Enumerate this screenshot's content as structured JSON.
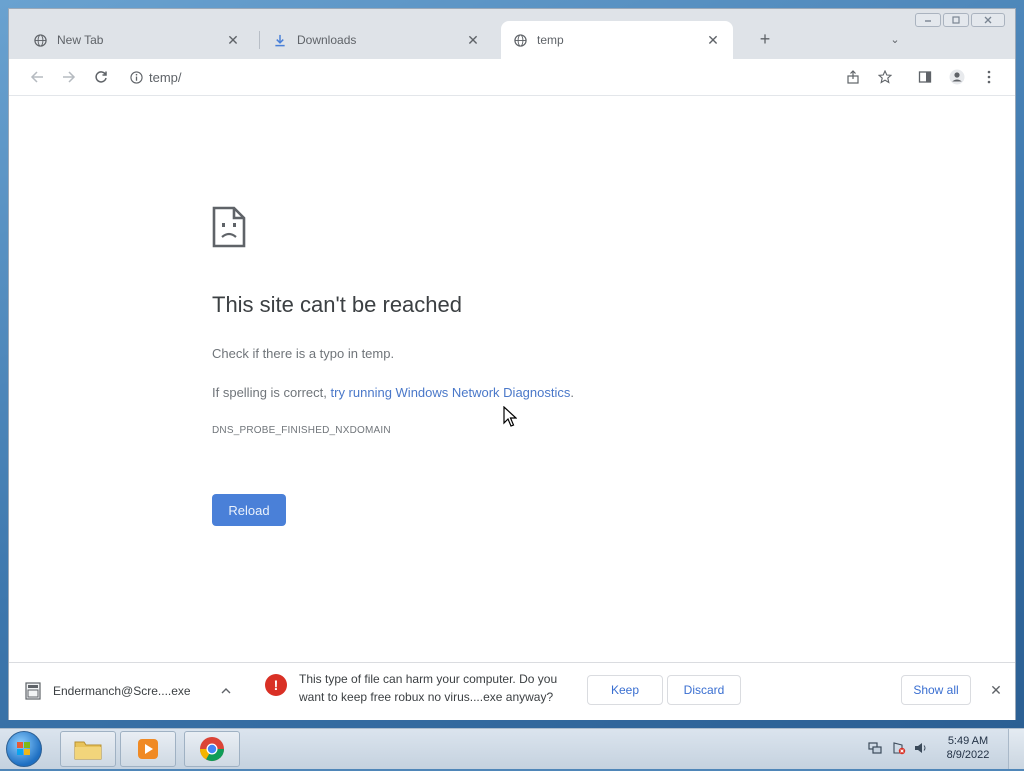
{
  "tabs": [
    {
      "label": "New Tab",
      "icon": "globe-icon",
      "close": "✕"
    },
    {
      "label": "Downloads",
      "icon": "download-icon",
      "close": "✕"
    },
    {
      "label": "temp",
      "icon": "globe-icon",
      "close": "✕",
      "active": true
    }
  ],
  "new_tab_glyph": "+",
  "tab_search_glyph": "⌄",
  "toolbar": {
    "url": "temp/",
    "icons": [
      "back-icon",
      "forward-icon",
      "reload-icon",
      "info-icon",
      "share-icon",
      "star-icon",
      "sidepanel-icon",
      "profile-icon",
      "menu-icon"
    ]
  },
  "error": {
    "title": "This site can't be reached",
    "line1": "Check if there is a typo in temp.",
    "line2_prefix": "If spelling is correct, ",
    "line2_link": "try running Windows Network Diagnostics",
    "line2_suffix": ".",
    "code": "DNS_PROBE_FINISHED_NXDOMAIN",
    "reload_label": "Reload"
  },
  "download_bar": {
    "file_name": "Endermanch@Scre....exe",
    "warning_line1": "This type of file can harm your computer. Do you",
    "warning_line2": "want to keep free robux no virus....exe anyway?",
    "keep_label": "Keep",
    "discard_label": "Discard",
    "show_all_label": "Show all",
    "close_glyph": "✕"
  },
  "taskbar": {
    "apps": [
      "explorer-icon",
      "media-player-icon",
      "chrome-icon"
    ],
    "time": "5:49 AM",
    "date": "8/9/2022"
  },
  "colors": {
    "accent": "#4a80d8",
    "link": "#4a78c9",
    "danger": "#d93025"
  }
}
